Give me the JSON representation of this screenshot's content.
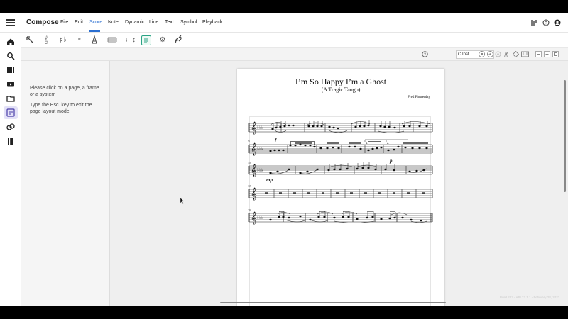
{
  "app": {
    "title": "Compose"
  },
  "menus": [
    "File",
    "Edit",
    "Score",
    "Note",
    "Dynamic",
    "Line",
    "Text",
    "Symbol",
    "Playback"
  ],
  "active_menu": "Score",
  "toolbar": {
    "icons": [
      "arrow-select-icon",
      "clef-icon",
      "key-signature-icon",
      "time-signature-icon",
      "tempo-icon",
      "measure-icon",
      "transpose-icon",
      "page-layout-icon",
      "settings-icon",
      "link-icon"
    ]
  },
  "rail": {
    "icons": [
      "home-icon",
      "search-icon",
      "library-icon",
      "video-icon",
      "folder-icon",
      "compose-icon",
      "record-icon",
      "book-icon"
    ]
  },
  "options": {
    "instrument": "C Inst."
  },
  "panel": {
    "line1": "Please click on a page, a frame or a system",
    "line2": "Type the Esc. key to exit the page layout mode"
  },
  "score": {
    "title": "I’m So Happy I’m a Ghost",
    "subtitle": "(A Tragic Tango)",
    "composer": "Fred Flowerday",
    "measure_numbers": [
      "5",
      "10",
      "15",
      "20"
    ],
    "dynamics": [
      "f",
      "p",
      "mp"
    ]
  },
  "footer": {
    "build": "Build 223 - API 22.1.1 - February 28, 2022"
  }
}
